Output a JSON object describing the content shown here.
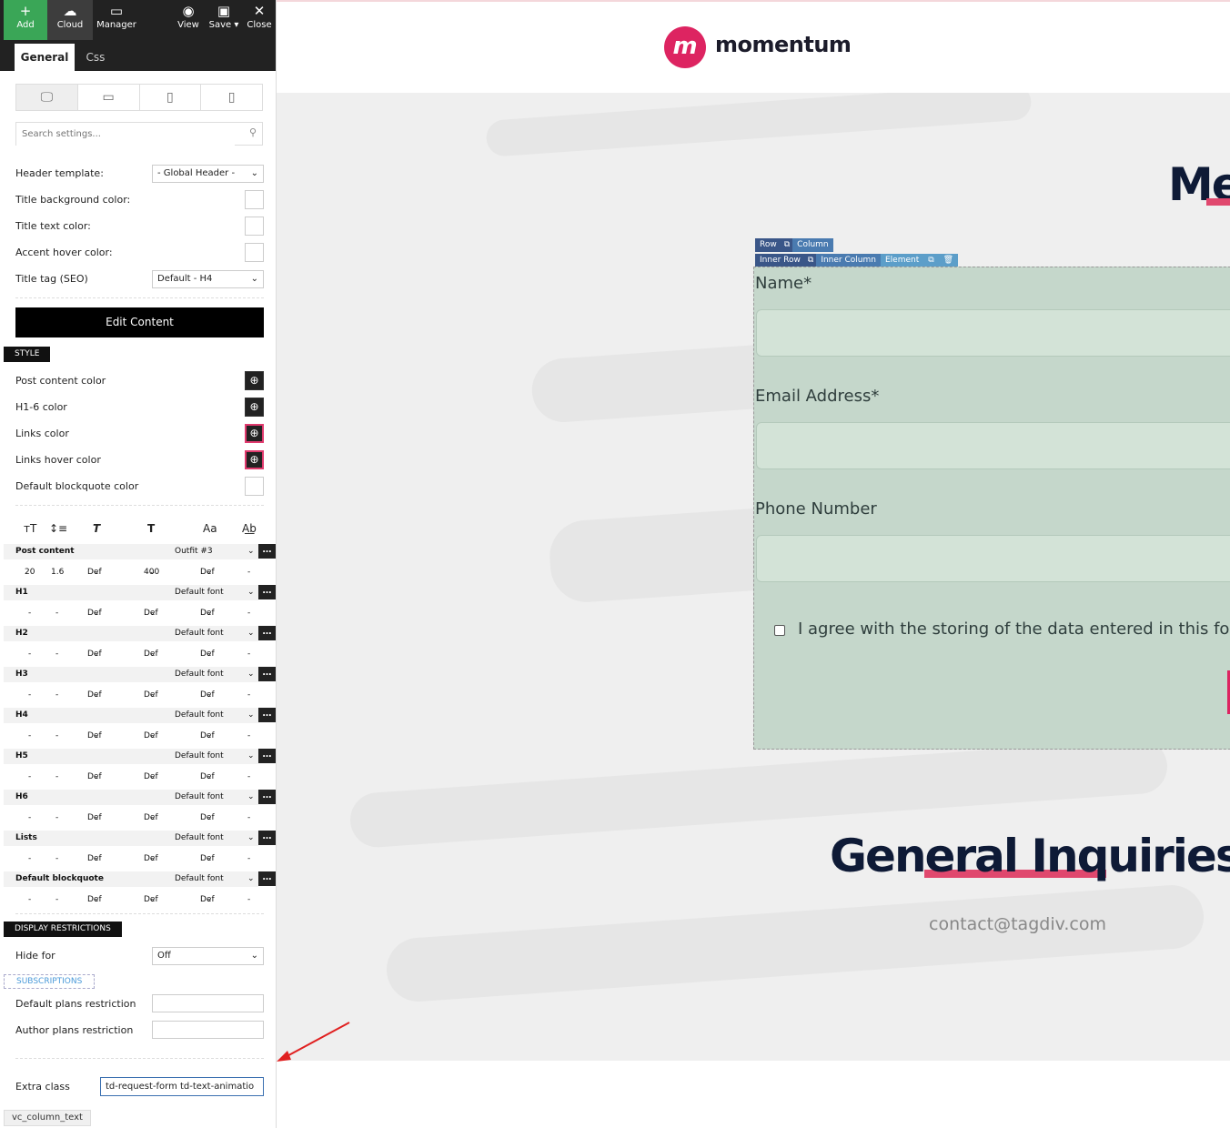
{
  "toolbar": {
    "add": "Add",
    "cloud": "Cloud",
    "manager": "Manager",
    "view": "View",
    "save": "Save",
    "close": "Close"
  },
  "tabs": {
    "general": "General",
    "css": "Css"
  },
  "search": {
    "placeholder": "Search settings..."
  },
  "settings": {
    "header_template_label": "Header template:",
    "header_template_value": "- Global Header -",
    "title_bg_color": "Title background color:",
    "title_text_color": "Title text color:",
    "accent_hover_color": "Accent hover color:",
    "title_tag_label": "Title tag (SEO)",
    "title_tag_value": "Default - H4",
    "edit_content": "Edit Content"
  },
  "style": {
    "tag": "STYLE",
    "post_content_color": "Post content color",
    "h16_color": "H1-6 color",
    "links_color": "Links color",
    "links_hover_color": "Links hover color",
    "blockquote_color": "Default blockquote color"
  },
  "typography": {
    "post_content": {
      "name": "Post content",
      "font": "Outfit #3",
      "v1": "20",
      "v2": "1.6",
      "v3": "Def",
      "v4": "400",
      "v5": "Def",
      "v6": "-"
    },
    "rows": [
      {
        "name": "H1",
        "font": "Default font"
      },
      {
        "name": "H2",
        "font": "Default font"
      },
      {
        "name": "H3",
        "font": "Default font"
      },
      {
        "name": "H4",
        "font": "Default font"
      },
      {
        "name": "H5",
        "font": "Default font"
      },
      {
        "name": "H6",
        "font": "Default font"
      },
      {
        "name": "Lists",
        "font": "Default font"
      },
      {
        "name": "Default blockquote",
        "font": "Default font"
      }
    ],
    "dash": "-",
    "def": "Def"
  },
  "display": {
    "tag": "DISPLAY RESTRICTIONS",
    "hide_for_label": "Hide for",
    "hide_for_value": "Off",
    "subscriptions": "SUBSCRIPTIONS",
    "default_plans": "Default plans restriction",
    "author_plans": "Author plans restriction",
    "extra_class_label": "Extra class",
    "extra_class_value": "td-request-form td-text-animatio",
    "shortcode": "vc_column_text"
  },
  "page": {
    "logo_text": "momentum",
    "me_title": "Me",
    "vc": {
      "row": "Row",
      "column": "Column",
      "inner_row": "Inner Row",
      "inner_column": "Inner Column",
      "element": "Element"
    },
    "form": {
      "name": "Name*",
      "email": "Email Address*",
      "phone": "Phone Number",
      "agree": "I agree with the storing of the data entered in this form"
    },
    "general_title": "General Inquiries",
    "contact_email": "contact@tagdiv.com"
  },
  "colors": {
    "add_green": "#3aa657",
    "brand_pink": "#dd2461",
    "form_bg": "#c5d7cb",
    "heading_navy": "#0e1a36",
    "annotation_red": "#e02020"
  }
}
